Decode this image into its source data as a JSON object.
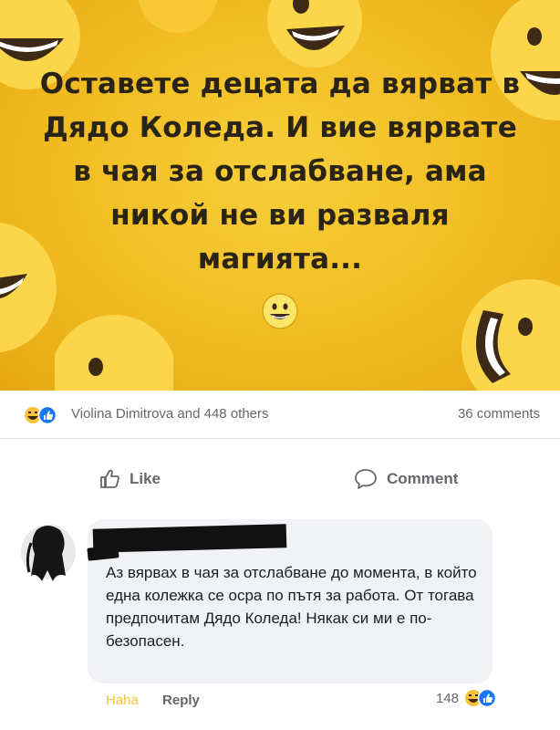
{
  "post": {
    "text": "Оставете децата да вярват в Дядо Коледа. И вие вярвате в чая за отслабване, ама никой не ви разваля магията...",
    "image_bg_color": "#f1bc22"
  },
  "reactions": {
    "icons": [
      "haha-icon",
      "like-icon"
    ],
    "reactors": "Violina Dimitrova and 448 others",
    "comments_count": "36 comments"
  },
  "actions": {
    "like_label": "Like",
    "comment_label": "Comment"
  },
  "comment": {
    "author": "",
    "text": "Аз вярвах в чая за отслабване до момента, в който една колежка се осра по пътя за работа. От тогава предпочитам Дядо Коледа! Някак си ми е по-безопасен.",
    "haha_label": "Haha",
    "reply_label": "Reply",
    "reaction_count": "148"
  }
}
